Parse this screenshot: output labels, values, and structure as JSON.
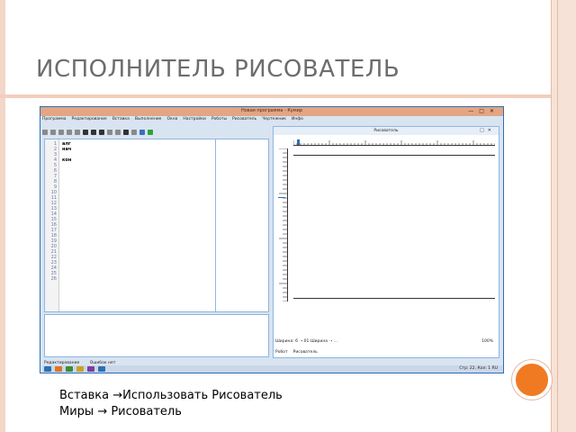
{
  "slide": {
    "title": "ИСПОЛНИТЕЛЬ РИСОВАТЕЛЬ",
    "caption_line1": "Вставка →Использовать Рисователь",
    "caption_line2": "Миры → Рисователь",
    "colors": {
      "accent": "#f07a22",
      "band": "#f2cdbd",
      "title": "#6d6d6d"
    }
  },
  "app": {
    "window_title": "Новая программа - Кумир",
    "menu": [
      "Программа",
      "Редактирование",
      "Вставка",
      "Выполнение",
      "Окна",
      "Настройки",
      "Роботы",
      "Рисователь",
      "Чертежник",
      "Инфо"
    ],
    "editor": {
      "line_numbers": [
        "1",
        "2",
        "3",
        "4",
        "5",
        "6",
        "7",
        "8",
        "9",
        "10",
        "11",
        "12",
        "13",
        "14",
        "15",
        "16",
        "17",
        "18",
        "19",
        "20",
        "21",
        "22",
        "23",
        "24",
        "25",
        "26"
      ],
      "code_lines": [
        "алг",
        "нач",
        "",
        "кон"
      ]
    },
    "status": {
      "mode": "Редактирование",
      "errors": "Ошибок нет"
    },
    "painter": {
      "title": "Рисователь",
      "status": "Ширина: 6 ➝ 01 Ширина ➝ ...",
      "zoom": "100%",
      "tabs": [
        "Робот",
        "Рисователь"
      ]
    },
    "taskbar": {
      "position": "Стр: 22, Кол: 1",
      "lang": "RU"
    }
  }
}
